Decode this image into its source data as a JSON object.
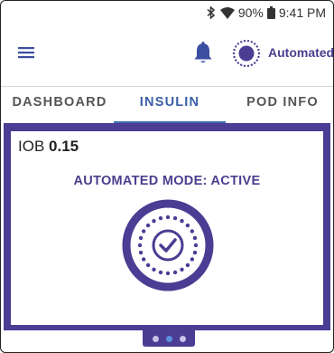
{
  "status_bar": {
    "battery": "90%",
    "time": "9:41 PM",
    "icons": [
      "bluetooth-icon",
      "wifi-icon",
      "battery-icon"
    ]
  },
  "app_bar": {
    "mode_label": "Automated",
    "icons": [
      "menu-icon",
      "bell-icon",
      "automated-mode-icon"
    ]
  },
  "tabs": [
    {
      "label": "DASHBOARD",
      "active": false
    },
    {
      "label": "INSULIN",
      "active": true
    },
    {
      "label": "POD INFO",
      "active": false
    }
  ],
  "iob": {
    "label": "IOB",
    "value": "0.15"
  },
  "mode_status": "AUTOMATED MODE: ACTIVE",
  "pager": {
    "count": 3,
    "active_index": 1
  },
  "colors": {
    "primary_purple": "#4a3d93",
    "tab_active_blue": "#3b5fa8",
    "pager_active": "#5d8fe0"
  }
}
